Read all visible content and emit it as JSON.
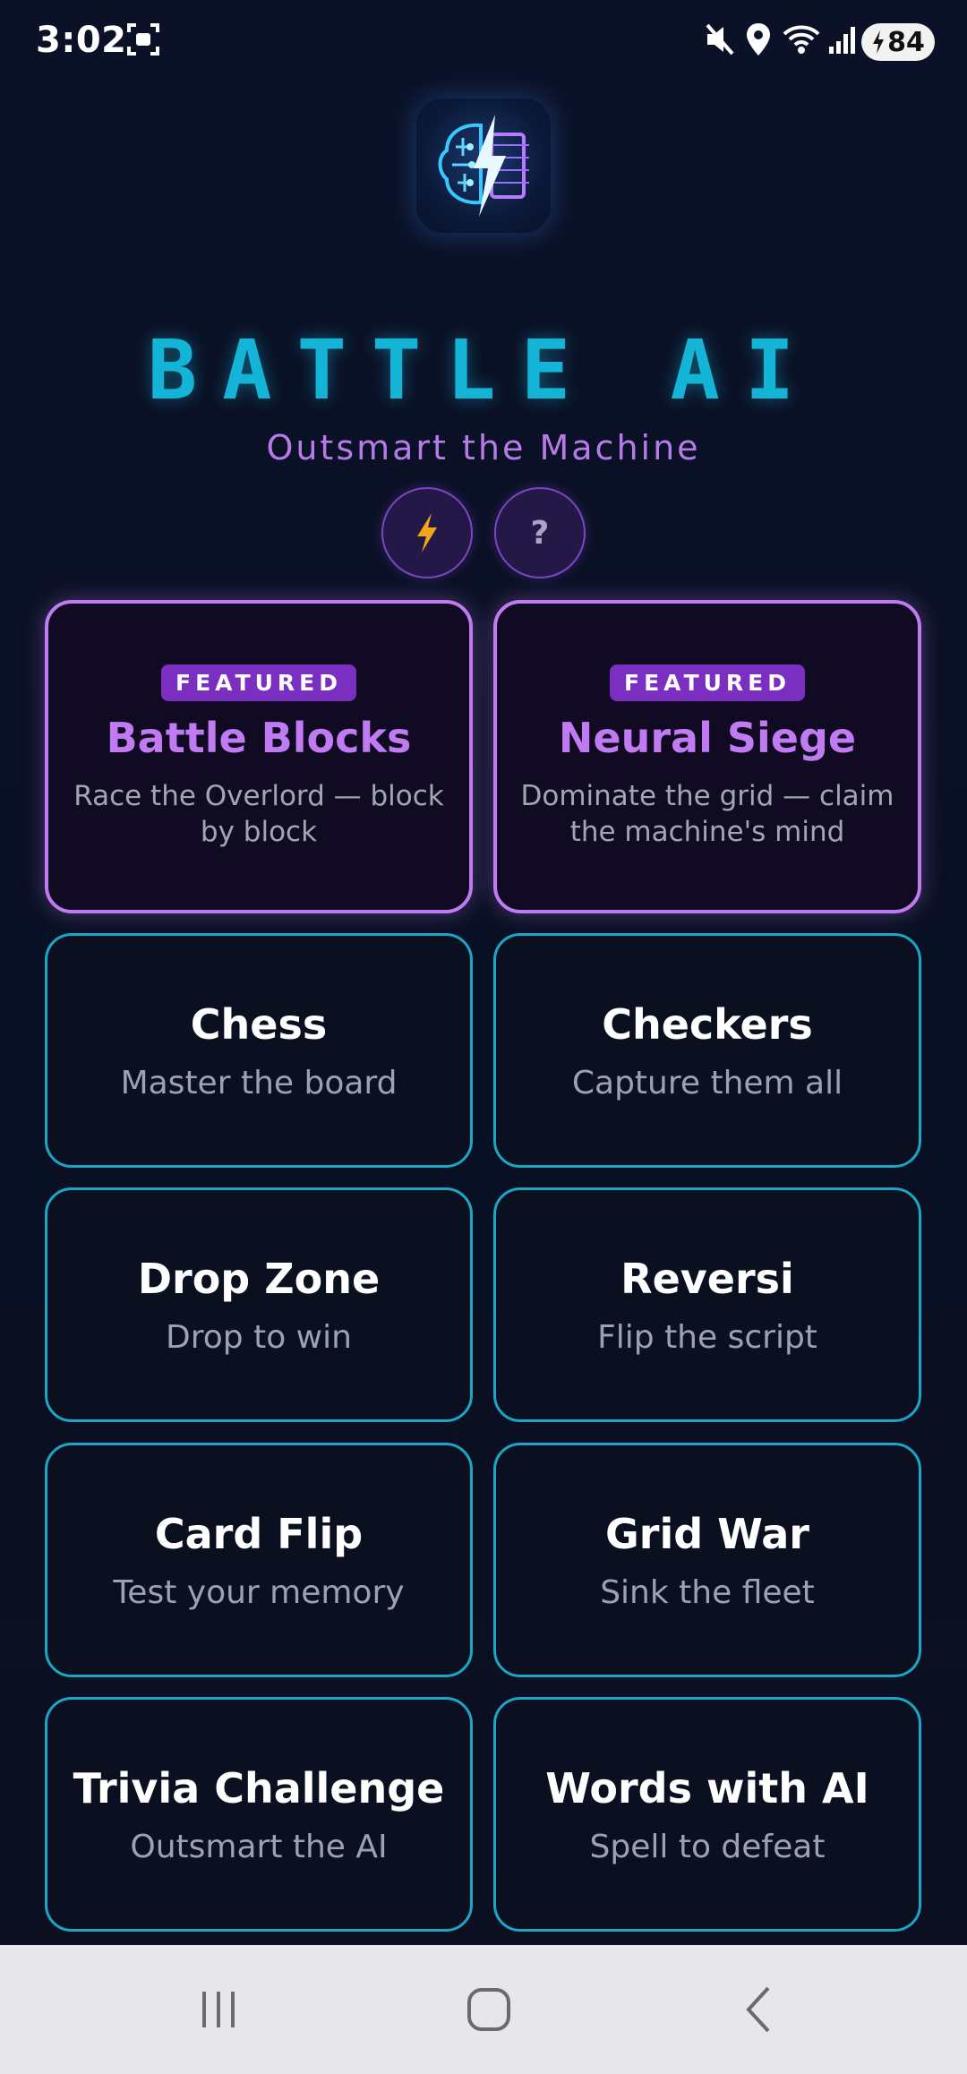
{
  "status_bar": {
    "time": "3:02",
    "battery": "84",
    "icons": [
      "screenshot-icon",
      "mute-icon",
      "location-icon",
      "wifi-icon",
      "signal-icon",
      "battery-charging-icon"
    ]
  },
  "app": {
    "title": "BATTLE AI",
    "subtitle": "Outsmart the Machine",
    "help_label": "?",
    "colors": {
      "accent_cyan": "#13b4d6",
      "accent_purple": "#c07af2",
      "background": "#0b1228"
    }
  },
  "featured": [
    {
      "badge": "FEATURED",
      "title": "Battle Blocks",
      "desc": "Race the Overlord — block by block"
    },
    {
      "badge": "FEATURED",
      "title": "Neural Siege",
      "desc": "Dominate the grid — claim the machine's mind"
    }
  ],
  "games": [
    {
      "title": "Chess",
      "desc": "Master the board"
    },
    {
      "title": "Checkers",
      "desc": "Capture them all"
    },
    {
      "title": "Drop Zone",
      "desc": "Drop to win"
    },
    {
      "title": "Reversi",
      "desc": "Flip the script"
    },
    {
      "title": "Card Flip",
      "desc": "Test your memory"
    },
    {
      "title": "Grid War",
      "desc": "Sink the fleet"
    },
    {
      "title": "Trivia Challenge",
      "desc": "Outsmart the AI"
    },
    {
      "title": "Words with AI",
      "desc": "Spell to defeat"
    }
  ]
}
